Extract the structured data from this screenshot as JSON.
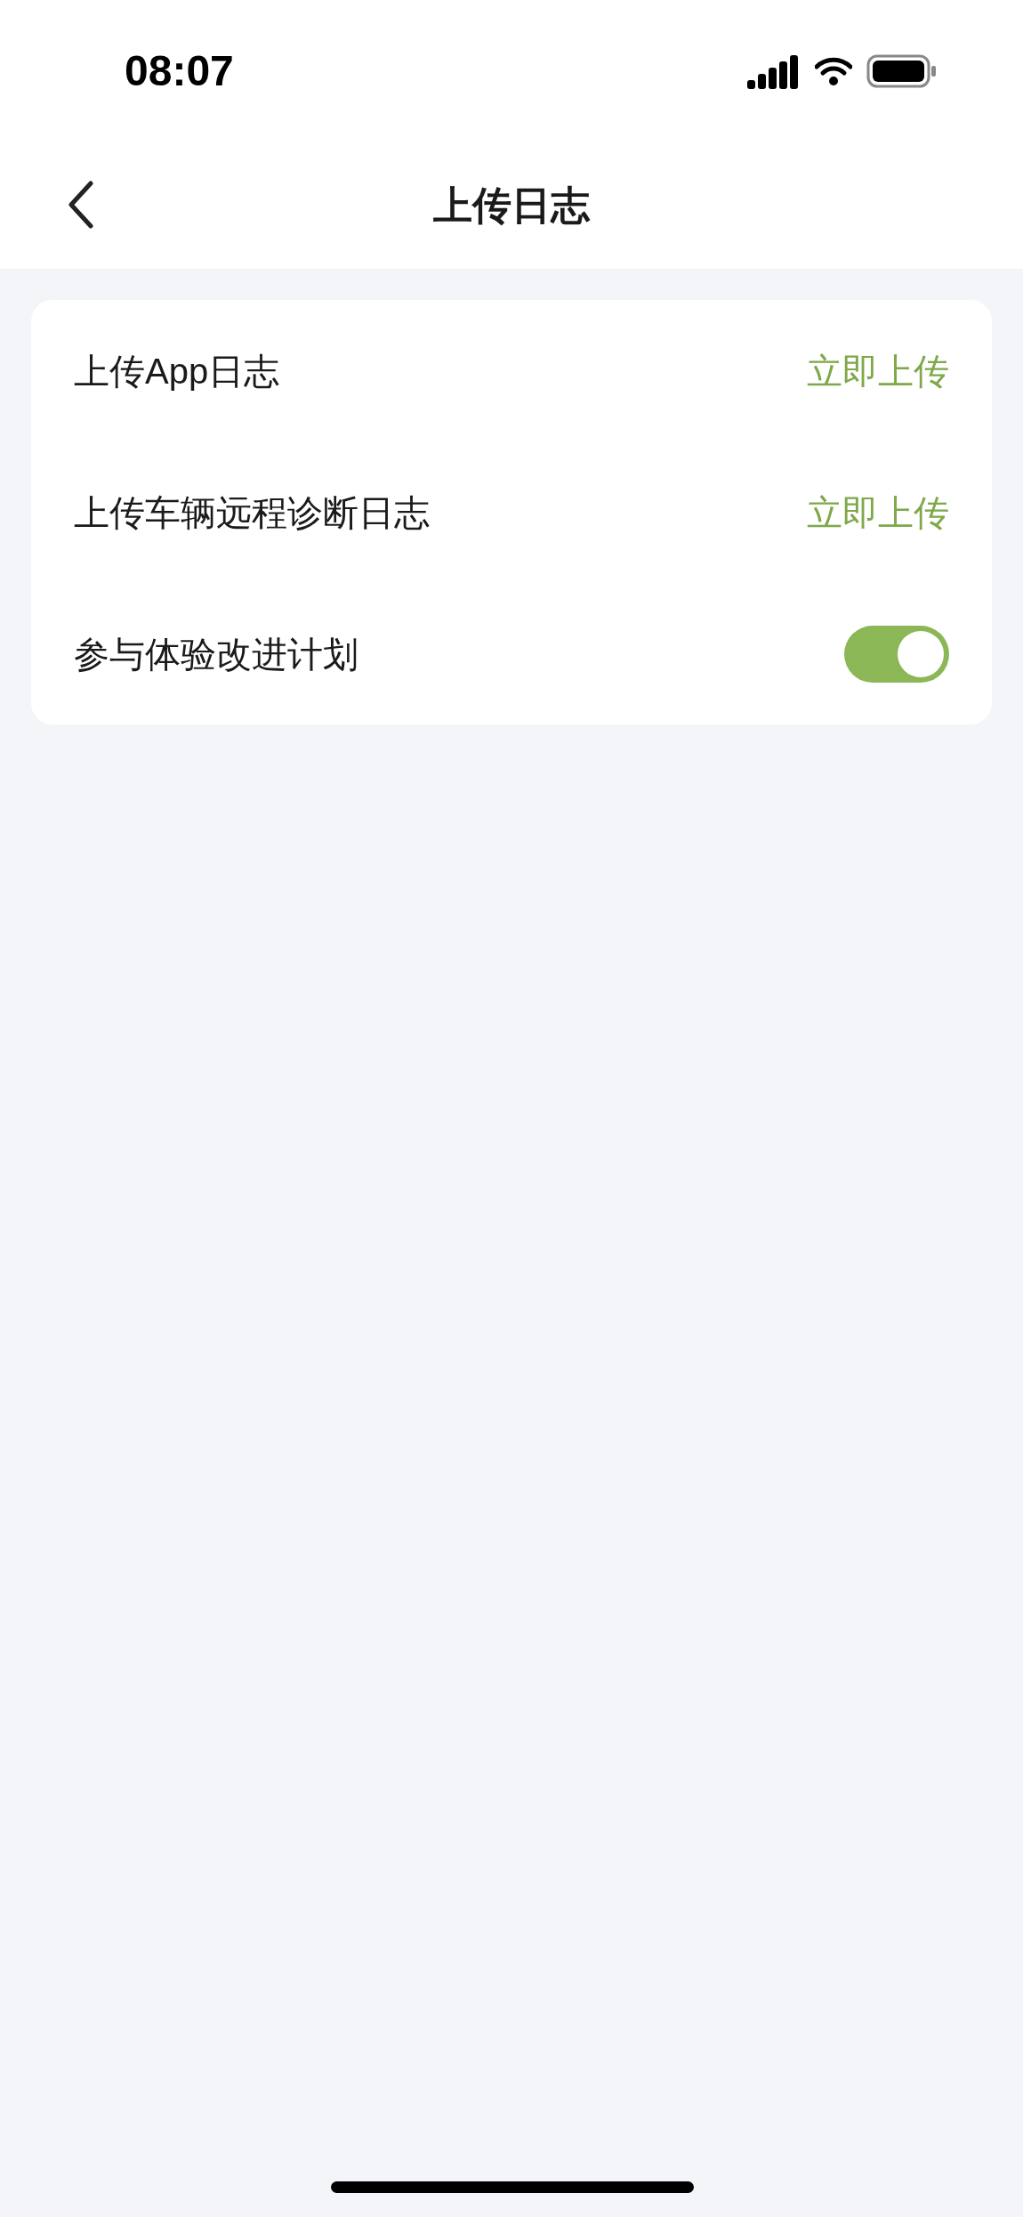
{
  "status_bar": {
    "time": "08:07"
  },
  "nav": {
    "title": "上传日志"
  },
  "settings": [
    {
      "kind": "action",
      "label": "上传App日志",
      "action": "立即上传"
    },
    {
      "kind": "action",
      "label": "上传车辆远程诊断日志",
      "action": "立即上传"
    },
    {
      "kind": "toggle",
      "label": "参与体验改进计划",
      "on": true
    }
  ]
}
